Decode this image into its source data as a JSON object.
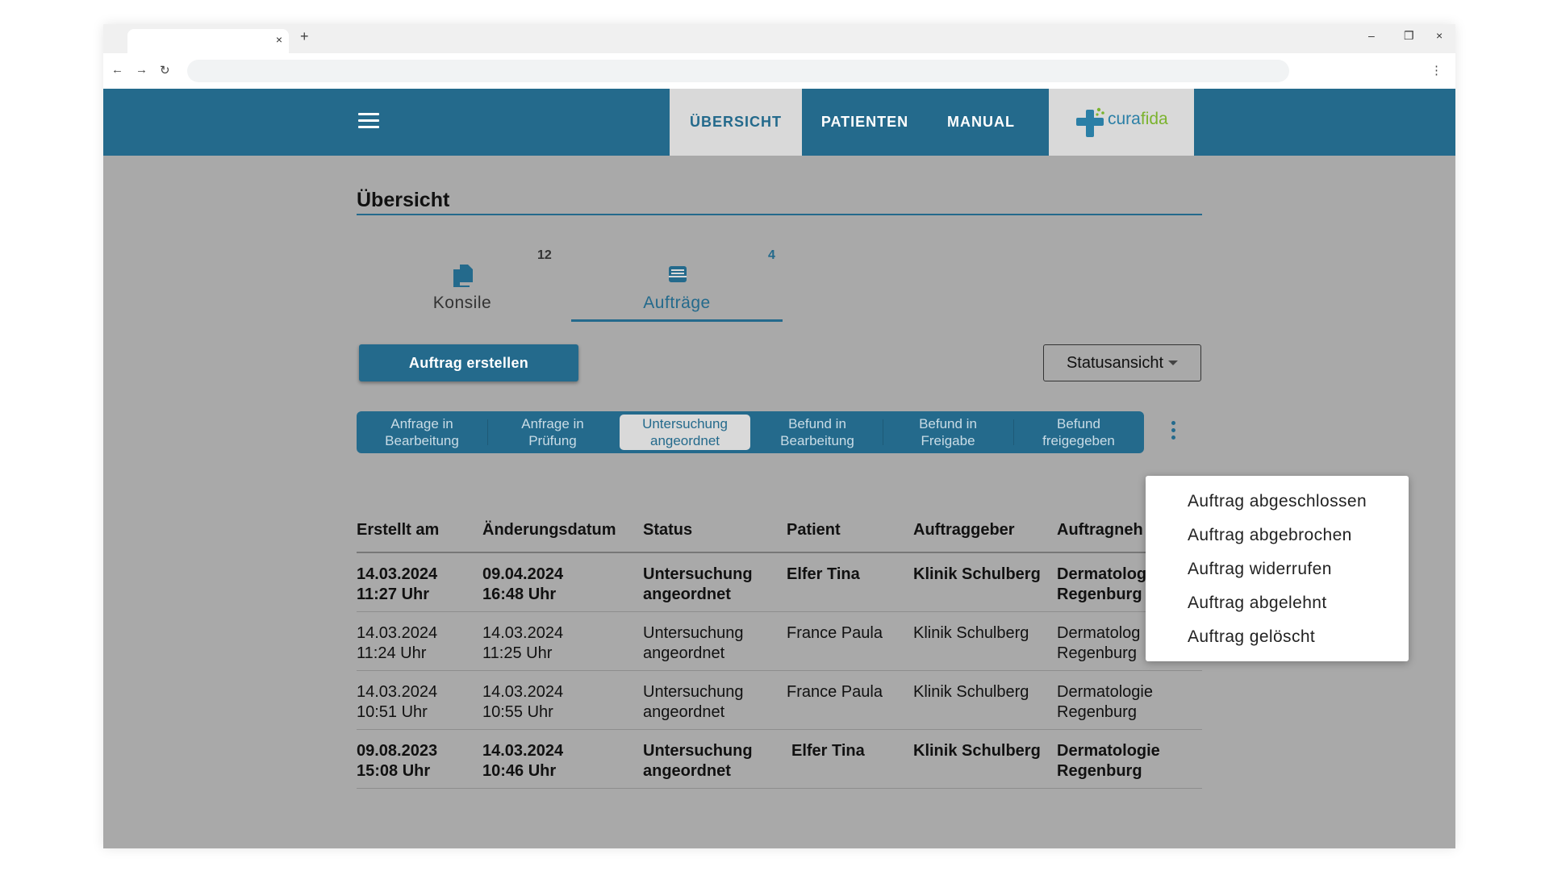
{
  "browser": {
    "tab_close": "×",
    "new_tab": "+",
    "minimize": "–",
    "restore": "❐",
    "close": "×",
    "back": "←",
    "forward": "→",
    "reload": "↻",
    "menu": "⋮"
  },
  "header": {
    "nav": [
      "ÜBERSICHT",
      "PATIENTEN",
      "MANUAL"
    ],
    "logo_a": "cura",
    "logo_b": "fida",
    "brand_color": "#246a8c"
  },
  "page": {
    "title": "Übersicht"
  },
  "content_tabs": [
    {
      "label": "Konsile",
      "count": "12",
      "icon": "documents-icon"
    },
    {
      "label": "Aufträge",
      "count": "4",
      "icon": "inbox-icon"
    }
  ],
  "actions": {
    "create": "Auftrag erstellen",
    "status_view": "Statusansicht"
  },
  "status_filters": [
    {
      "line1": "Anfrage in",
      "line2": "Bearbeitung"
    },
    {
      "line1": "Anfrage in",
      "line2": "Prüfung"
    },
    {
      "line1": "Untersuchung",
      "line2": "angeordnet"
    },
    {
      "line1": "Befund in",
      "line2": "Bearbeitung"
    },
    {
      "line1": "Befund in",
      "line2": "Freigabe"
    },
    {
      "line1": "Befund",
      "line2": "freigegeben"
    }
  ],
  "table": {
    "headers": [
      "Erstellt am",
      "Änderungsdatum",
      "Status",
      "Patient",
      "Auftraggeber",
      "Auftragneh"
    ],
    "rows": [
      {
        "created": "14.03.2024",
        "created_time": "11:27 Uhr",
        "changed": "09.04.2024",
        "changed_time": "16:48 Uhr",
        "status1": "Untersuchung",
        "status2": "angeordnet",
        "patient": "Elfer Tina",
        "client": "Klinik Schulberg",
        "contractor1": "Dermatolog",
        "contractor2": "Regenburg"
      },
      {
        "created": "14.03.2024",
        "created_time": "11:24 Uhr",
        "changed": "14.03.2024",
        "changed_time": "11:25 Uhr",
        "status1": "Untersuchung",
        "status2": "angeordnet",
        "patient": "France Paula",
        "client": "Klinik Schulberg",
        "contractor1": "Dermatolog",
        "contractor2": "Regenburg"
      },
      {
        "created": "14.03.2024",
        "created_time": "10:51 Uhr",
        "changed": "14.03.2024",
        "changed_time": "10:55 Uhr",
        "status1": "Untersuchung",
        "status2": "angeordnet",
        "patient": "France Paula",
        "client": "Klinik Schulberg",
        "contractor1": "Dermatologie",
        "contractor2": "Regenburg"
      },
      {
        "created": "09.08.2023",
        "created_time": "15:08 Uhr",
        "changed": "14.03.2024",
        "changed_time": "10:46 Uhr",
        "status1": "Untersuchung",
        "status2": "angeordnet",
        "patient": "Elfer Tina",
        "client": "Klinik Schulberg",
        "contractor1": "Dermatologie",
        "contractor2": "Regenburg"
      }
    ]
  },
  "menu": {
    "items": [
      "Auftrag abgeschlossen",
      "Auftrag abgebrochen",
      "Auftrag widerrufen",
      "Auftrag abgelehnt",
      "Auftrag gelöscht"
    ]
  }
}
